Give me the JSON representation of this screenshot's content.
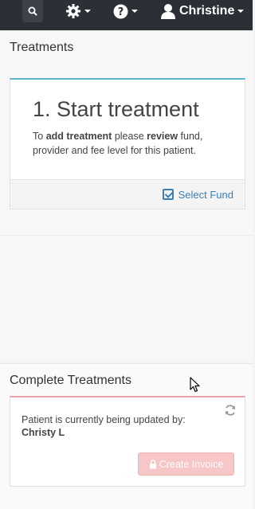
{
  "topbar": {
    "user_name": "Christine"
  },
  "treatments": {
    "title": "Treatments",
    "card": {
      "heading": "1. Start treatment",
      "text_prefix": "To ",
      "text_bold1": "add treatment",
      "text_mid": " please ",
      "text_bold2": "review",
      "text_suffix": " fund, provider and fee level for this patient.",
      "select_fund_label": "Select Fund"
    }
  },
  "complete_treatments": {
    "title": "Complete Treatments",
    "updating_text": "Patient is currently being updated by:",
    "updating_user": "Christy L",
    "create_invoice_label": "Create Invoice"
  },
  "colors": {
    "topbar": "#2b2f36",
    "accent_blue": "#3b7fb5",
    "card_border_blue": "#5ab4d2",
    "card_border_red": "#e8a4a4",
    "invoice_button_disabled": "#f7c6c6"
  },
  "icons": [
    "search-icon",
    "gear-icon",
    "help-icon",
    "user-icon",
    "checkbox-icon",
    "refresh-icon",
    "lock-icon",
    "mouse-cursor"
  ]
}
